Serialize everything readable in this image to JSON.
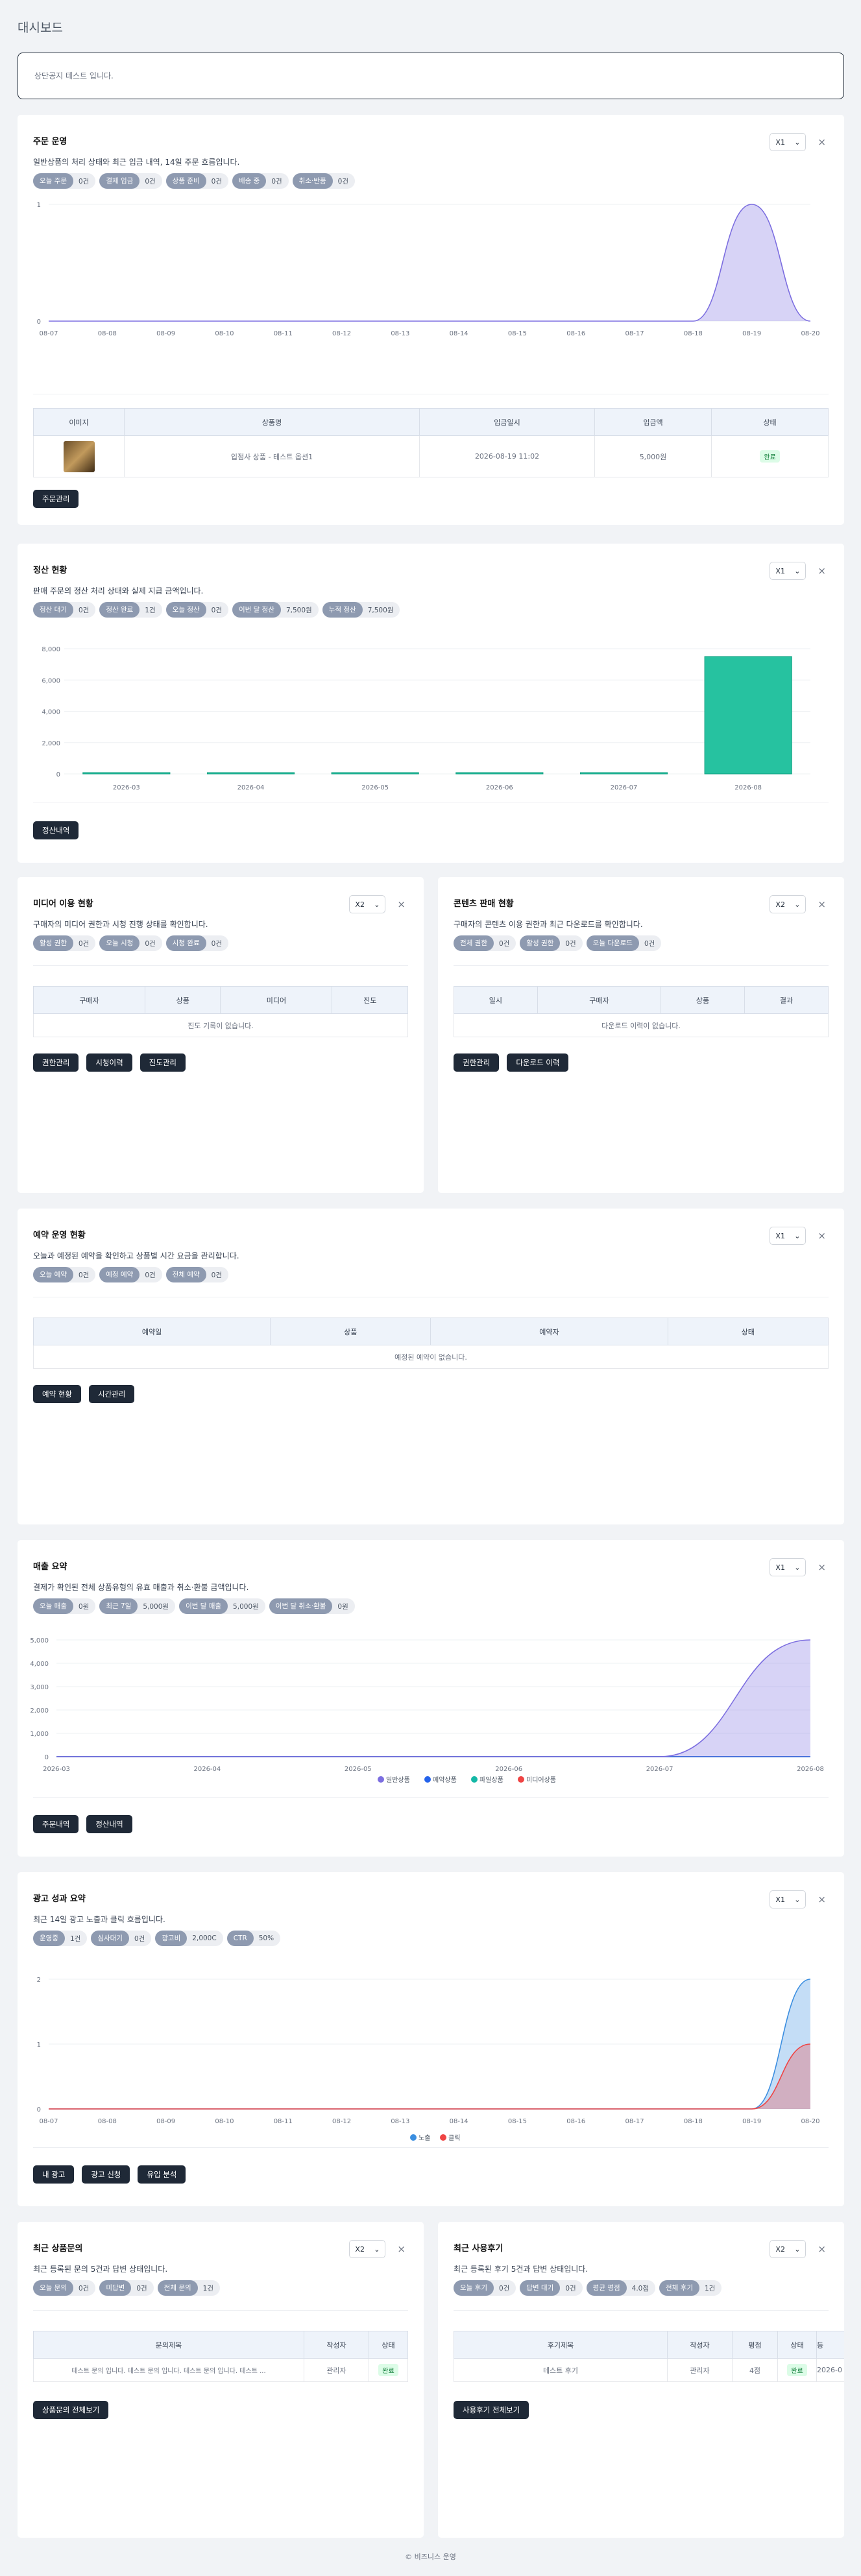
{
  "page_title": "대시보드",
  "notice": "상단공지 테스트 입니다.",
  "orders": {
    "title": "주문 운영",
    "desc": "일반상품의 처리 상태와 최근 입금 내역, 14일 주문 흐름입니다.",
    "select": "X1",
    "pills": [
      {
        "k": "오늘 주문",
        "v": "0건"
      },
      {
        "k": "결제 입금",
        "v": "0건"
      },
      {
        "k": "상품 준비",
        "v": "0건"
      },
      {
        "k": "배송 중",
        "v": "0건"
      },
      {
        "k": "취소·반품",
        "v": "0건"
      }
    ],
    "table": {
      "headers": [
        "이미지",
        "상품명",
        "입금일시",
        "입금액",
        "상태"
      ],
      "row": {
        "name": "입점사 상품 - 테스트 옵션1",
        "date": "2026-08-19 11:02",
        "amount": "5,000원",
        "status": "완료"
      }
    },
    "buttons": [
      "주문관리"
    ]
  },
  "orders_chart": {
    "type": "area",
    "x": [
      "08-07",
      "08-08",
      "08-09",
      "08-10",
      "08-11",
      "08-12",
      "08-13",
      "08-14",
      "08-15",
      "08-16",
      "08-17",
      "08-18",
      "08-19",
      "08-20"
    ],
    "y_ticks": [
      "0",
      "1"
    ],
    "values": [
      0,
      0,
      0,
      0,
      0,
      0,
      0,
      0,
      0,
      0,
      0,
      0,
      1,
      0
    ],
    "ylim": [
      0,
      1
    ],
    "color": "#7c6ee0"
  },
  "settle": {
    "title": "정산 현황",
    "desc": "판매 주문의 정산 처리 상태와 실제 지급 금액입니다.",
    "select": "X1",
    "pills": [
      {
        "k": "정산 대기",
        "v": "0건"
      },
      {
        "k": "정산 완료",
        "v": "1건"
      },
      {
        "k": "오늘 정산",
        "v": "0건"
      },
      {
        "k": "이번 달 정산",
        "v": "7,500원"
      },
      {
        "k": "누적 정산",
        "v": "7,500원"
      }
    ],
    "buttons": [
      "정산내역"
    ]
  },
  "settle_chart": {
    "type": "bar",
    "categories": [
      "2026-03",
      "2026-04",
      "2026-05",
      "2026-06",
      "2026-07",
      "2026-08"
    ],
    "values": [
      0,
      0,
      0,
      0,
      0,
      7500
    ],
    "y_ticks": [
      "0",
      "2,000",
      "4,000",
      "6,000",
      "8,000"
    ],
    "ylim": [
      0,
      8000
    ],
    "color": "#26c2a0"
  },
  "media": {
    "title": "미디어 이용 현황",
    "desc": "구매자의 미디어 권한과 시청 진행 상태를 확인합니다.",
    "select": "X2",
    "pills": [
      {
        "k": "활성 권한",
        "v": "0건"
      },
      {
        "k": "오늘 시청",
        "v": "0건"
      },
      {
        "k": "시청 완료",
        "v": "0건"
      }
    ],
    "headers": [
      "구매자",
      "상품",
      "미디어",
      "진도"
    ],
    "empty": "진도 기록이 없습니다.",
    "buttons": [
      "권한관리",
      "시청이력",
      "진도관리"
    ]
  },
  "content": {
    "title": "콘텐츠 판매 현황",
    "desc": "구매자의 콘텐츠 이용 권한과 최근 다운로드를 확인합니다.",
    "select": "X2",
    "pills": [
      {
        "k": "전체 권한",
        "v": "0건"
      },
      {
        "k": "활성 권한",
        "v": "0건"
      },
      {
        "k": "오늘 다운로드",
        "v": "0건"
      }
    ],
    "headers": [
      "일시",
      "구매자",
      "상품",
      "결과"
    ],
    "empty": "다운로드 이력이 없습니다.",
    "buttons": [
      "권한관리",
      "다운로드 이력"
    ]
  },
  "reserve": {
    "title": "예약 운영 현황",
    "desc": "오늘과 예정된 예약을 확인하고 상품별 시간 요금을 관리합니다.",
    "select": "X1",
    "pills": [
      {
        "k": "오늘 예약",
        "v": "0건"
      },
      {
        "k": "예정 예약",
        "v": "0건"
      },
      {
        "k": "전체 예약",
        "v": "0건"
      }
    ],
    "headers": [
      "예약일",
      "상품",
      "예약자",
      "상태"
    ],
    "empty": "예정된 예약이 없습니다.",
    "buttons": [
      "예약 현황",
      "시간관리"
    ]
  },
  "sales": {
    "title": "매출 요약",
    "desc": "결제가 확인된 전체 상품유형의 유효 매출과 취소·환불 금액입니다.",
    "select": "X1",
    "pills": [
      {
        "k": "오늘 매출",
        "v": "0원"
      },
      {
        "k": "최근 7일",
        "v": "5,000원"
      },
      {
        "k": "이번 달 매출",
        "v": "5,000원"
      },
      {
        "k": "이번 달 취소·환불",
        "v": "0원"
      }
    ],
    "buttons": [
      "주문내역",
      "정산내역"
    ]
  },
  "sales_chart": {
    "type": "area",
    "x": [
      "2026-03",
      "2026-04",
      "2026-05",
      "2026-06",
      "2026-07",
      "2026-08"
    ],
    "y_ticks": [
      "0",
      "1,000",
      "2,000",
      "3,000",
      "4,000",
      "5,000"
    ],
    "ylim": [
      0,
      5000
    ],
    "series": [
      {
        "name": "일반상품",
        "values": [
          0,
          0,
          0,
          0,
          0,
          5000
        ],
        "color": "#7c6ee0"
      },
      {
        "name": "예약상품",
        "values": [
          0,
          0,
          0,
          0,
          0,
          0
        ],
        "color": "#2563eb"
      },
      {
        "name": "파일상품",
        "values": [
          0,
          0,
          0,
          0,
          0,
          0
        ],
        "color": "#14b8a6"
      },
      {
        "name": "미디어상품",
        "values": [
          0,
          0,
          0,
          0,
          0,
          0
        ],
        "color": "#ef4444"
      }
    ]
  },
  "ads": {
    "title": "광고 성과 요약",
    "desc": "최근 14일 광고 노출과 클릭 흐름입니다.",
    "select": "X1",
    "pills": [
      {
        "k": "운영중",
        "v": "1건"
      },
      {
        "k": "심사대기",
        "v": "0건"
      },
      {
        "k": "광고비",
        "v": "2,000C"
      },
      {
        "k": "CTR",
        "v": "50%"
      }
    ],
    "buttons": [
      "내 광고",
      "광고 신청",
      "유입 분석"
    ]
  },
  "ads_chart": {
    "type": "area",
    "x": [
      "08-07",
      "08-08",
      "08-09",
      "08-10",
      "08-11",
      "08-12",
      "08-13",
      "08-14",
      "08-15",
      "08-16",
      "08-17",
      "08-18",
      "08-19",
      "08-20"
    ],
    "y_ticks": [
      "0",
      "1",
      "2"
    ],
    "ylim": [
      0,
      2
    ],
    "series": [
      {
        "name": "노출",
        "values": [
          0,
          0,
          0,
          0,
          0,
          0,
          0,
          0,
          0,
          0,
          0,
          0,
          0,
          2
        ],
        "color": "#3b8ee0"
      },
      {
        "name": "클릭",
        "values": [
          0,
          0,
          0,
          0,
          0,
          0,
          0,
          0,
          0,
          0,
          0,
          0,
          0,
          1
        ],
        "color": "#ef4444"
      }
    ]
  },
  "qna": {
    "title": "최근 상품문의",
    "desc": "최근 등록된 문의 5건과 답변 상태입니다.",
    "select": "X2",
    "pills": [
      {
        "k": "오늘 문의",
        "v": "0건"
      },
      {
        "k": "미답변",
        "v": "0건"
      },
      {
        "k": "전체 문의",
        "v": "1건"
      }
    ],
    "headers": [
      "문의제목",
      "작성자",
      "상태"
    ],
    "row": [
      "테스트 문의 입니다. 테스트 문의 입니다. 테스트 문의 입니다. 테스트 ...",
      "관리자",
      "완료"
    ],
    "buttons": [
      "상품문의 전체보기"
    ]
  },
  "review": {
    "title": "최근 사용후기",
    "desc": "최근 등록된 후기 5건과 답변 상태입니다.",
    "select": "X2",
    "pills": [
      {
        "k": "오늘 후기",
        "v": "0건"
      },
      {
        "k": "답변 대기",
        "v": "0건"
      },
      {
        "k": "평균 평점",
        "v": "4.0점"
      },
      {
        "k": "전체 후기",
        "v": "1건"
      }
    ],
    "headers": [
      "후기제목",
      "작성자",
      "평점",
      "상태",
      "등"
    ],
    "row": [
      "테스트 후기",
      "관리자",
      "4점",
      "완료",
      "2026-0"
    ],
    "buttons": [
      "사용후기 전체보기"
    ]
  },
  "footer": "© 비즈니스 운영"
}
